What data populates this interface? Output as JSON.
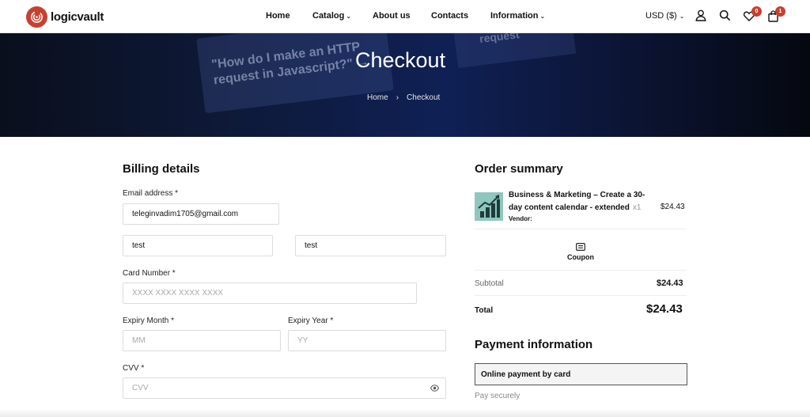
{
  "header": {
    "logo_text": "logicvault",
    "nav": [
      {
        "label": "Home"
      },
      {
        "label": "Catalog",
        "chevron": true
      },
      {
        "label": "About us"
      },
      {
        "label": "Contacts"
      },
      {
        "label": "Information",
        "chevron": true
      }
    ],
    "currency": "USD ($)",
    "wishlist_count": "0",
    "cart_count": "1",
    "accent_color": "#c8402f"
  },
  "hero": {
    "title": "Checkout",
    "bg_text_1": "\"How do I make an HTTP request in Javascript?\" →",
    "bg_text_2": "request",
    "breadcrumb": [
      "Home",
      "›",
      "Checkout"
    ]
  },
  "billing": {
    "heading": "Billing details",
    "email_label": "Email address *",
    "email_value": "teleginvadim1705@gmail.com",
    "first_name_value": "test",
    "last_name_value": "test",
    "card_label": "Card Number *",
    "card_placeholder": "XXXX XXXX XXXX XXXX",
    "expiry_month_label": "Expiry Month *",
    "expiry_month_placeholder": "MM",
    "expiry_year_label": "Expiry Year *",
    "expiry_year_placeholder": "YY",
    "cvv_label": "CVV *",
    "cvv_placeholder": "CVV"
  },
  "order": {
    "heading": "Order summary",
    "item_name": "Business & Marketing – Create a 30-day content calendar - extended",
    "item_qty": "x1",
    "item_price": "$24.43",
    "vendor_label": "Vendor:",
    "coupon_label": "Coupon",
    "subtotal_label": "Subtotal",
    "subtotal_value": "$24.43",
    "total_label": "Total",
    "total_value": "$24.43"
  },
  "payment": {
    "heading": "Payment information",
    "method": "Online payment by card",
    "subtext": "Pay securely"
  }
}
